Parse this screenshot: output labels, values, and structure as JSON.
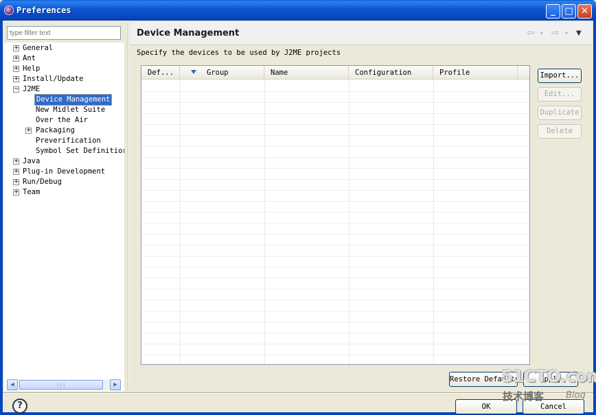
{
  "window": {
    "title": "Preferences"
  },
  "filter": {
    "placeholder": "type filter text"
  },
  "tree": [
    {
      "label": "General",
      "expander": "+"
    },
    {
      "label": "Ant",
      "expander": "+"
    },
    {
      "label": "Help",
      "expander": "+"
    },
    {
      "label": "Install/Update",
      "expander": "+"
    },
    {
      "label": "J2ME",
      "expander": "−"
    },
    {
      "label": "Device Management",
      "expander": ""
    },
    {
      "label": "New Midlet Suite",
      "expander": ""
    },
    {
      "label": "Over the Air",
      "expander": ""
    },
    {
      "label": "Packaging",
      "expander": "+"
    },
    {
      "label": "Preverification",
      "expander": ""
    },
    {
      "label": "Symbol Set Definitior",
      "expander": ""
    },
    {
      "label": "Java",
      "expander": "+"
    },
    {
      "label": "Plug-in Development",
      "expander": "+"
    },
    {
      "label": "Run/Debug",
      "expander": "+"
    },
    {
      "label": "Team",
      "expander": "+"
    }
  ],
  "page": {
    "title": "Device Management",
    "description": "Specify the devices to be used by J2ME projects",
    "nav": {
      "back": "⇦",
      "forward": "⇨",
      "dropdown": "▾",
      "menu": "▼"
    }
  },
  "table": {
    "columns": [
      "Def...",
      "Group",
      "Name",
      "Configuration",
      "Profile"
    ]
  },
  "buttons": {
    "import": "Import...",
    "edit": "Edit...",
    "duplicate": "Duplicate",
    "delete": "Delete",
    "restore_defaults": "Restore Defaults",
    "apply": "Apply",
    "ok": "OK",
    "cancel": "Cancel",
    "help": "?"
  },
  "scrollbar": {
    "left_arrow": "◀",
    "right_arrow": "▶",
    "grip": "|||"
  },
  "watermark": {
    "line1": "51CTO.com",
    "line2": "技术博客",
    "line3": "Blog"
  },
  "icons": [
    "window-icon",
    "minimize-icon",
    "maximize-icon",
    "close-icon",
    "back-arrow-icon",
    "forward-arrow-icon",
    "view-menu-icon",
    "help-icon",
    "sort-indicator-icon"
  ]
}
